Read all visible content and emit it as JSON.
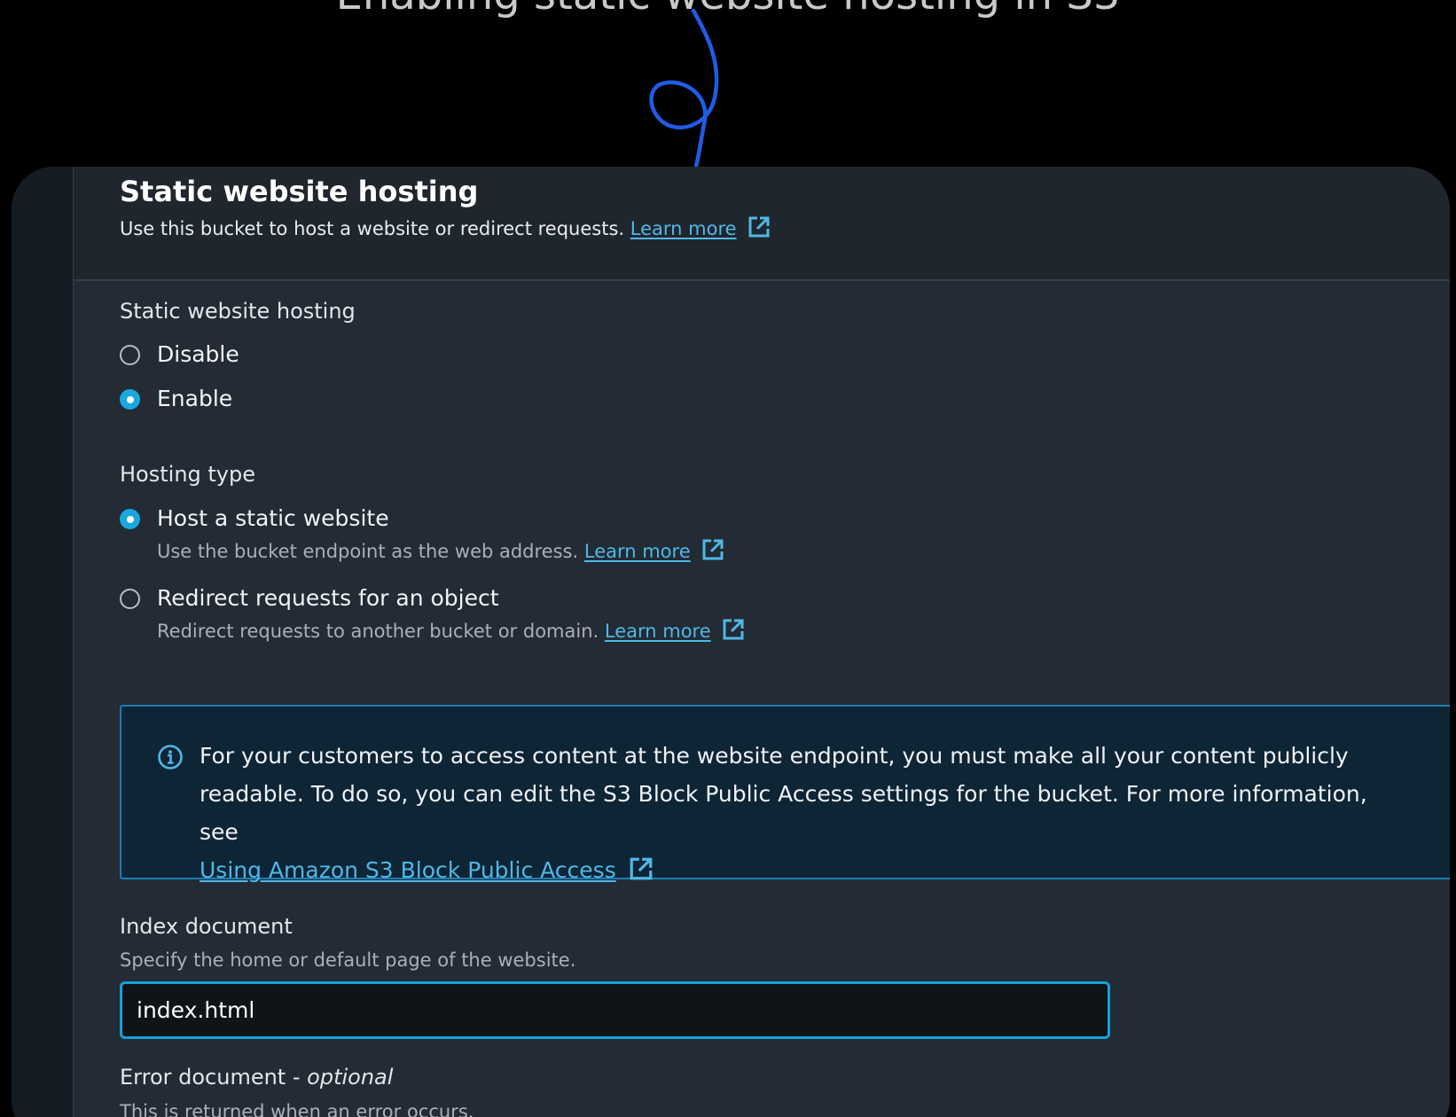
{
  "header": {
    "title": "Static website hosting",
    "description": "Use this bucket to host a website or redirect requests.",
    "learn_more": "Learn more"
  },
  "hosting_toggle": {
    "label": "Static website hosting",
    "options": [
      {
        "label": "Disable",
        "selected": false
      },
      {
        "label": "Enable",
        "selected": true
      }
    ]
  },
  "hosting_type": {
    "label": "Hosting type",
    "options": [
      {
        "label": "Host a static website",
        "description": "Use the bucket endpoint as the web address.",
        "link": "Learn more",
        "selected": true
      },
      {
        "label": "Redirect requests for an object",
        "description": "Redirect requests to another bucket or domain.",
        "link": "Learn more",
        "selected": false
      }
    ]
  },
  "info_alert": {
    "icon": "info-icon",
    "text": "For your customers to access content at the website endpoint, you must make all your content publicly readable. To do so, you can edit the S3 Block Public Access settings for the bucket. For more information, see",
    "link": "Using Amazon S3 Block Public Access"
  },
  "index_document": {
    "label": "Index document",
    "description": "Specify the home or default page of the website.",
    "value": "index.html"
  },
  "error_document": {
    "label": "Error document -",
    "optional": "optional",
    "description": "This is returned when an error occurs."
  },
  "colors": {
    "accent": "#1aa7e0",
    "link": "#4fb8e6",
    "panel_bg": "#232b35",
    "info_bg": "#0e2536",
    "annotation_arrow": "#1f5ce6"
  }
}
